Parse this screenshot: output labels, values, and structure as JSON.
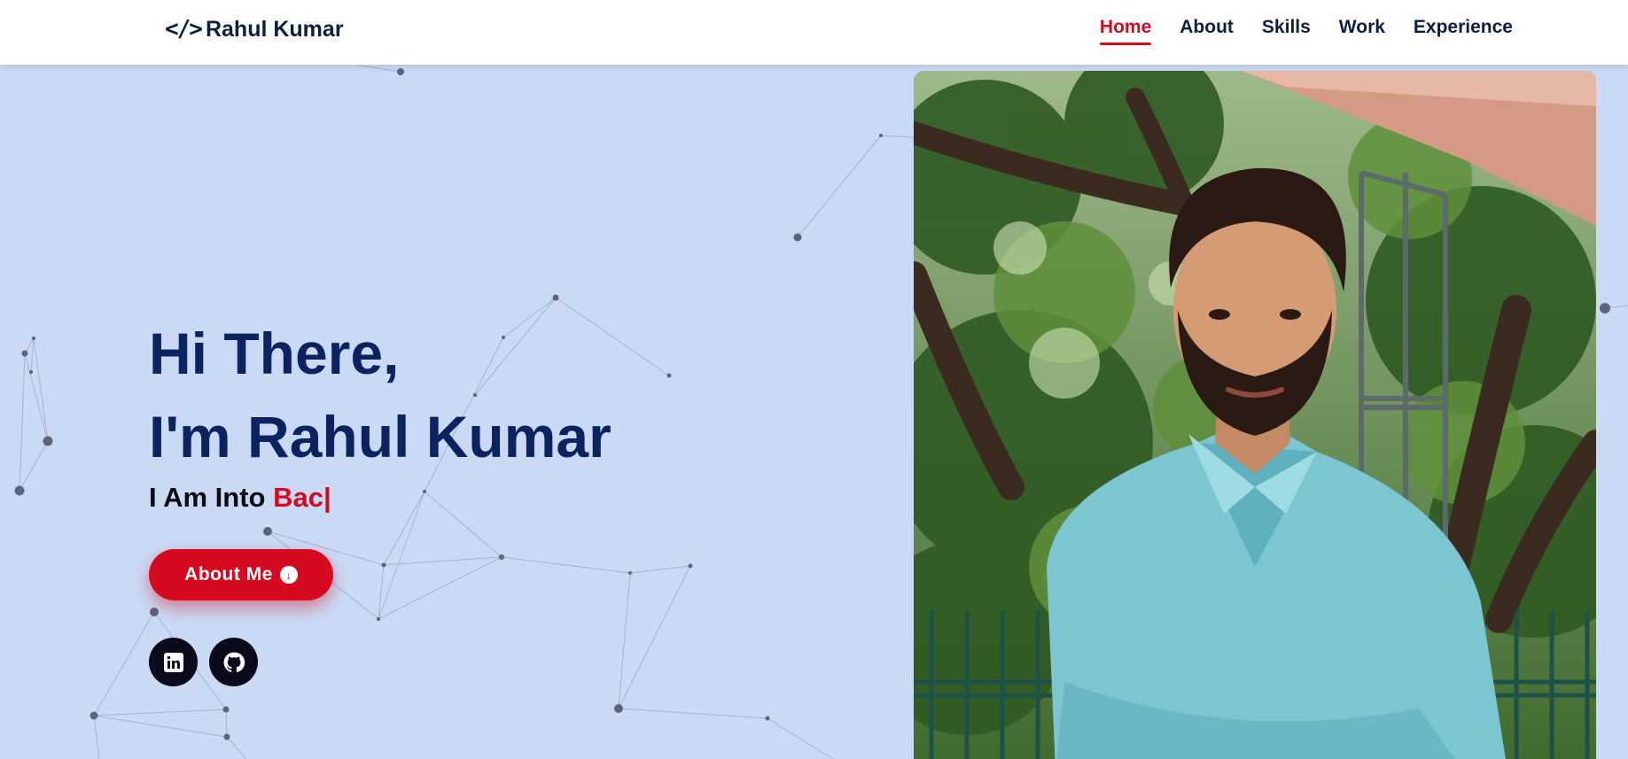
{
  "header": {
    "brand": {
      "icon": "code-icon",
      "name": "Rahul Kumar"
    },
    "nav": [
      {
        "label": "Home",
        "active": true
      },
      {
        "label": "About",
        "active": false
      },
      {
        "label": "Skills",
        "active": false
      },
      {
        "label": "Work",
        "active": false
      },
      {
        "label": "Experience",
        "active": false
      }
    ]
  },
  "hero": {
    "greeting": "Hi There,",
    "intro": "I'm Rahul Kumar",
    "typing_prefix": "I Am Into",
    "typing_text": "Bac|",
    "button": {
      "label": "About Me",
      "icon": "arrow-down-circle-icon"
    },
    "social": [
      {
        "icon": "linkedin-icon"
      },
      {
        "icon": "github-icon"
      }
    ]
  },
  "photo": {
    "subject": "portrait-photo"
  },
  "colors": {
    "background": "#cadaf5",
    "accent": "#d60a1e",
    "heading": "#0b2460",
    "dark": "#0c0b1e"
  }
}
